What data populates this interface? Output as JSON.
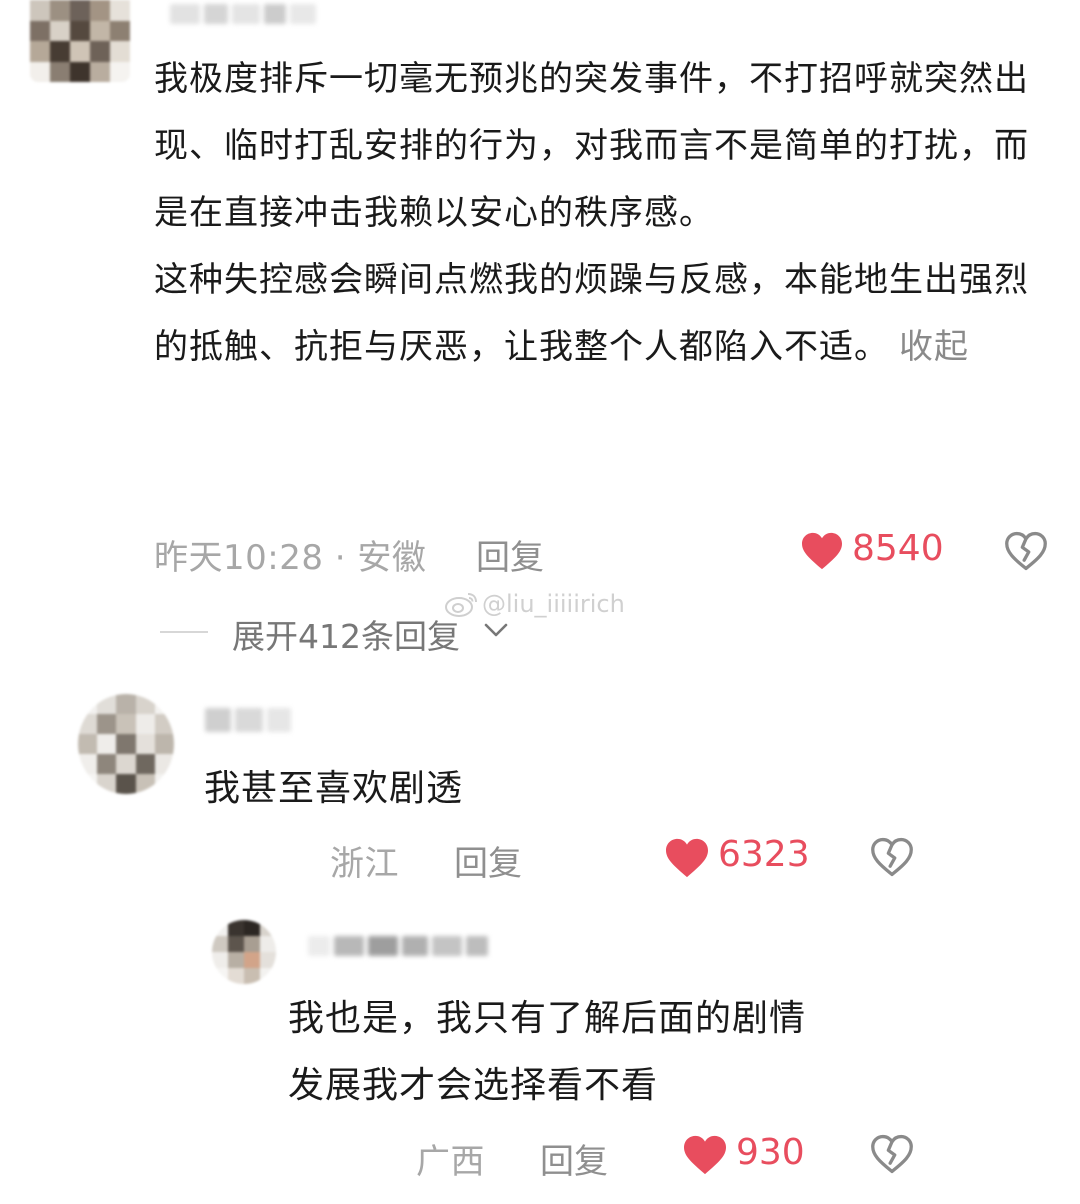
{
  "comments": [
    {
      "text_paragraphs": [
        "我极度排斥一切毫无预兆的突发事件，不打招呼就突然出现、临时打乱安排的行为，对我而言不是简单的打扰，而是在直接冲击我赖以安心的秩序感。",
        "这种失控感会瞬间点燃我的烦躁与反感，本能地生出强烈的抵触、抗拒与厌恶，让我整个人都陷入不适。"
      ],
      "collapse_label": "收起",
      "meta": "昨天10:28 · 安徽",
      "reply_label": "回复",
      "likes": "8540",
      "expand_replies_label": "展开412条回复"
    },
    {
      "text": "我甚至喜欢剧透",
      "location": "浙江",
      "reply_label": "回复",
      "likes": "6323"
    },
    {
      "text_lines": [
        "我也是，我只有了解后面的剧情",
        "发展我才会选择看不看"
      ],
      "location": "广西",
      "reply_label": "回复",
      "likes": "930"
    }
  ],
  "watermark": "@liu_iiiiirich",
  "colors": {
    "like_red": "#e84d5e",
    "meta_gray": "#a7a7a7",
    "text": "#1a1a1a"
  },
  "icons": [
    "heart-filled-icon",
    "broken-heart-icon",
    "chevron-down-icon",
    "weibo-logo-icon"
  ]
}
